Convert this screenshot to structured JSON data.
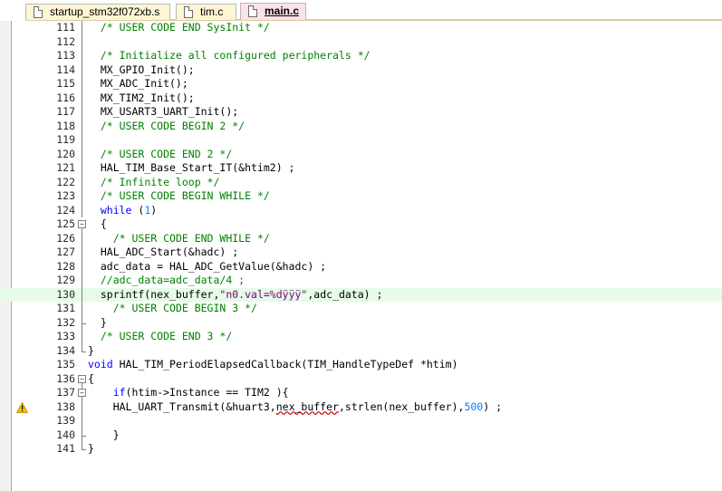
{
  "tabs": [
    {
      "label": "startup_stm32f072xb.s",
      "active": false
    },
    {
      "label": "tim.c",
      "active": false
    },
    {
      "label": "main.c",
      "active": true
    }
  ],
  "editor": {
    "highlight_line": 130,
    "warning_line": 138,
    "lines": [
      {
        "n": "111",
        "fold": "bar",
        "tokens": [
          [
            "  ",
            ""
          ],
          [
            "/* USER CODE END SysInit */",
            "comment"
          ]
        ]
      },
      {
        "n": "112",
        "fold": "bar",
        "tokens": []
      },
      {
        "n": "113",
        "fold": "bar",
        "tokens": [
          [
            "  ",
            ""
          ],
          [
            "/* Initialize all configured peripherals */",
            "comment"
          ]
        ]
      },
      {
        "n": "114",
        "fold": "bar",
        "tokens": [
          [
            "  MX_GPIO_Init();",
            ""
          ]
        ]
      },
      {
        "n": "115",
        "fold": "bar",
        "tokens": [
          [
            "  MX_ADC_Init();",
            ""
          ]
        ]
      },
      {
        "n": "116",
        "fold": "bar",
        "tokens": [
          [
            "  MX_TIM2_Init();",
            ""
          ]
        ]
      },
      {
        "n": "117",
        "fold": "bar",
        "tokens": [
          [
            "  MX_USART3_UART_Init();",
            ""
          ]
        ]
      },
      {
        "n": "118",
        "fold": "bar",
        "tokens": [
          [
            "  ",
            ""
          ],
          [
            "/* USER CODE BEGIN 2 */",
            "comment"
          ]
        ]
      },
      {
        "n": "119",
        "fold": "bar",
        "tokens": []
      },
      {
        "n": "120",
        "fold": "bar",
        "tokens": [
          [
            "  ",
            ""
          ],
          [
            "/* USER CODE END 2 */",
            "comment"
          ]
        ]
      },
      {
        "n": "121",
        "fold": "bar",
        "tokens": [
          [
            "  HAL_TIM_Base_Start_IT(&htim2) ;",
            ""
          ]
        ]
      },
      {
        "n": "122",
        "fold": "bar",
        "tokens": [
          [
            "  ",
            ""
          ],
          [
            "/* Infinite loop */",
            "comment"
          ]
        ]
      },
      {
        "n": "123",
        "fold": "bar",
        "tokens": [
          [
            "  ",
            ""
          ],
          [
            "/* USER CODE BEGIN WHILE */",
            "comment"
          ]
        ]
      },
      {
        "n": "124",
        "fold": "bar",
        "tokens": [
          [
            "  ",
            ""
          ],
          [
            "while",
            "keyword"
          ],
          [
            " (",
            ""
          ],
          [
            "1",
            "number"
          ],
          [
            ")",
            ""
          ]
        ]
      },
      {
        "n": "125",
        "fold": "open",
        "tokens": [
          [
            "  {",
            ""
          ]
        ]
      },
      {
        "n": "126",
        "fold": "bar",
        "tokens": [
          [
            "    ",
            ""
          ],
          [
            "/* USER CODE END WHILE */",
            "comment"
          ]
        ]
      },
      {
        "n": "127",
        "fold": "bar",
        "tokens": [
          [
            "  HAL_ADC_Start(&hadc) ;",
            ""
          ]
        ]
      },
      {
        "n": "128",
        "fold": "bar",
        "tokens": [
          [
            "  adc_data = HAL_ADC_GetValue(&hadc) ;",
            ""
          ]
        ]
      },
      {
        "n": "129",
        "fold": "bar",
        "tokens": [
          [
            "  ",
            ""
          ],
          [
            "//adc_data=adc_data/4 ;",
            "comment"
          ]
        ]
      },
      {
        "n": "130",
        "fold": "bar",
        "tokens": [
          [
            "  sprintf(nex_buffer,",
            ""
          ],
          [
            "\"n0.val=%dÿÿÿ\"",
            "string"
          ],
          [
            ",adc_data) ;",
            ""
          ]
        ]
      },
      {
        "n": "131",
        "fold": "bar",
        "tokens": [
          [
            "    ",
            ""
          ],
          [
            "/* USER CODE BEGIN 3 */",
            "comment"
          ]
        ]
      },
      {
        "n": "132",
        "fold": "tick",
        "tokens": [
          [
            "  }",
            ""
          ]
        ]
      },
      {
        "n": "133",
        "fold": "bar",
        "tokens": [
          [
            "  ",
            ""
          ],
          [
            "/* USER CODE END 3 */",
            "comment"
          ]
        ]
      },
      {
        "n": "134",
        "fold": "end",
        "tokens": [
          [
            "}",
            ""
          ]
        ]
      },
      {
        "n": "135",
        "fold": "",
        "tokens": [
          [
            "void",
            "keyword"
          ],
          [
            " HAL_TIM_PeriodElapsedCallback(TIM_HandleTypeDef *htim)",
            ""
          ]
        ]
      },
      {
        "n": "136",
        "fold": "open",
        "tokens": [
          [
            "{",
            ""
          ]
        ]
      },
      {
        "n": "137",
        "fold": "open2",
        "tokens": [
          [
            "    ",
            ""
          ],
          [
            "if",
            "keyword"
          ],
          [
            "(htim->Instance == TIM2 ){",
            ""
          ]
        ]
      },
      {
        "n": "138",
        "fold": "bar",
        "tokens": [
          [
            "    HAL_UART_Transmit(&huart3,",
            ""
          ],
          [
            "nex_buffer",
            "squig"
          ],
          [
            ",strlen(nex_buffer),",
            ""
          ],
          [
            "500",
            "number"
          ],
          [
            ") ;",
            ""
          ]
        ]
      },
      {
        "n": "139",
        "fold": "bar",
        "tokens": []
      },
      {
        "n": "140",
        "fold": "tick",
        "tokens": [
          [
            "    }",
            ""
          ]
        ]
      },
      {
        "n": "141",
        "fold": "end",
        "tokens": [
          [
            "}",
            ""
          ]
        ]
      }
    ]
  },
  "icons": {
    "file": "file-icon",
    "warning": "warning-icon",
    "fold": "fold-toggle-icon"
  },
  "colors": {
    "comment": "#008000",
    "keyword": "#0000ff",
    "number": "#0080ff",
    "highlight": "#e6fbe8",
    "active_tab": "#fbe2e9",
    "tab": "#fdf5d3"
  }
}
